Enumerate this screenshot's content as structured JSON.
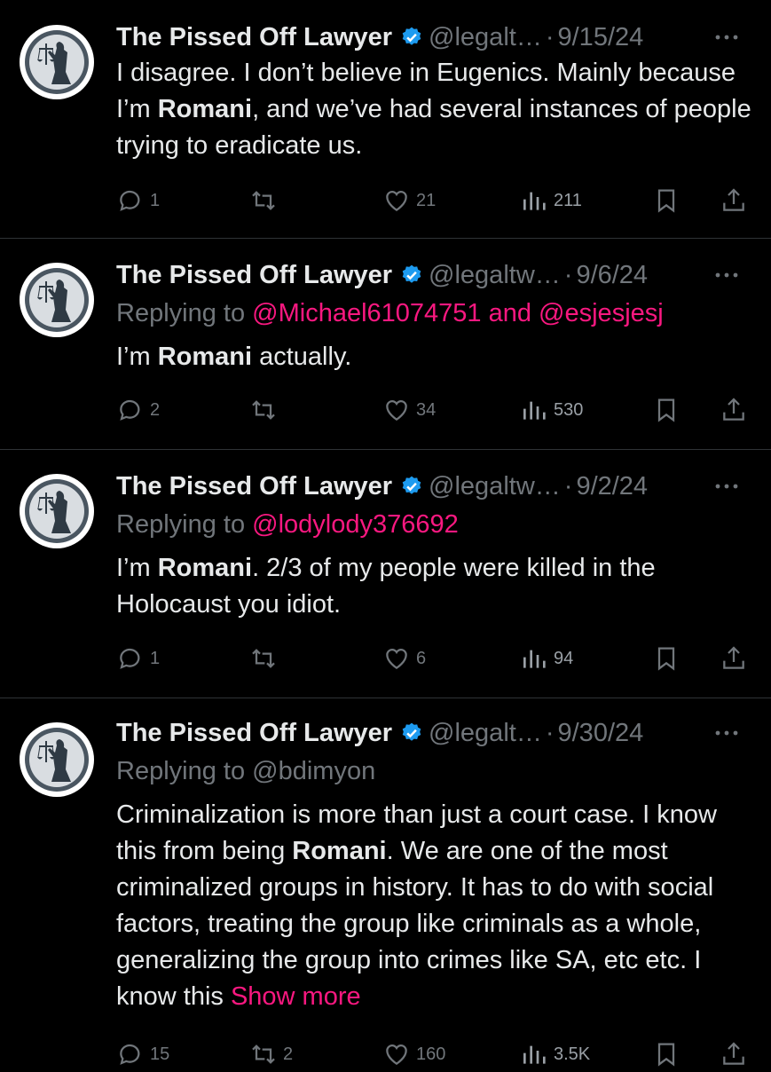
{
  "colors": {
    "background": "#000000",
    "text": "#e7e9ea",
    "muted": "#71767b",
    "mention": "#f91880",
    "verified": "#1d9bf0",
    "divider": "#2f3336"
  },
  "tweets": [
    {
      "name": "The Pissed Off Lawyer",
      "handle": "@legalt…",
      "dot": "·",
      "date": "9/15/24",
      "reply_prefix": "",
      "reply_mentions": "",
      "body_1": "I disagree. I don’t believe in Eugenics. Mainly because I’m ",
      "body_bold": "Romani",
      "body_2": ", and we’ve had several instances of people trying to eradicate us.",
      "show_more": "",
      "replies": "1",
      "retweets": "",
      "likes": "21",
      "views": "211"
    },
    {
      "name": "The Pissed Off Lawyer",
      "handle": "@legaltw…",
      "dot": "·",
      "date": "9/6/24",
      "reply_prefix": "Replying to ",
      "reply_mentions": "@Michael61074751 and @esjesjesj",
      "body_1": "I’m ",
      "body_bold": "Romani",
      "body_2": " actually.",
      "show_more": "",
      "replies": "2",
      "retweets": "",
      "likes": "34",
      "views": "530"
    },
    {
      "name": "The Pissed Off Lawyer",
      "handle": "@legaltw…",
      "dot": "·",
      "date": "9/2/24",
      "reply_prefix": "Replying to ",
      "reply_mentions": "@lodylody376692",
      "body_1": "I’m ",
      "body_bold": "Romani",
      "body_2": ". 2/3 of my people were killed in the Holocaust you idiot.",
      "show_more": "",
      "replies": "1",
      "retweets": "",
      "likes": "6",
      "views": "94"
    },
    {
      "name": "The Pissed Off Lawyer",
      "handle": "@legalt…",
      "dot": "·",
      "date": "9/30/24",
      "reply_prefix": "Replying to @bdimyon",
      "reply_mentions": "",
      "body_1": "Criminalization is more than just a court case. I know this from being ",
      "body_bold": "Romani",
      "body_2": ". We are one of the most criminalized groups in history. It has to do with social factors, treating the group like criminals as a whole, generalizing the group into crimes like SA, etc etc. I know this ",
      "show_more": "Show more",
      "replies": "15",
      "retweets": "2",
      "likes": "160",
      "views": "3.5K"
    }
  ]
}
